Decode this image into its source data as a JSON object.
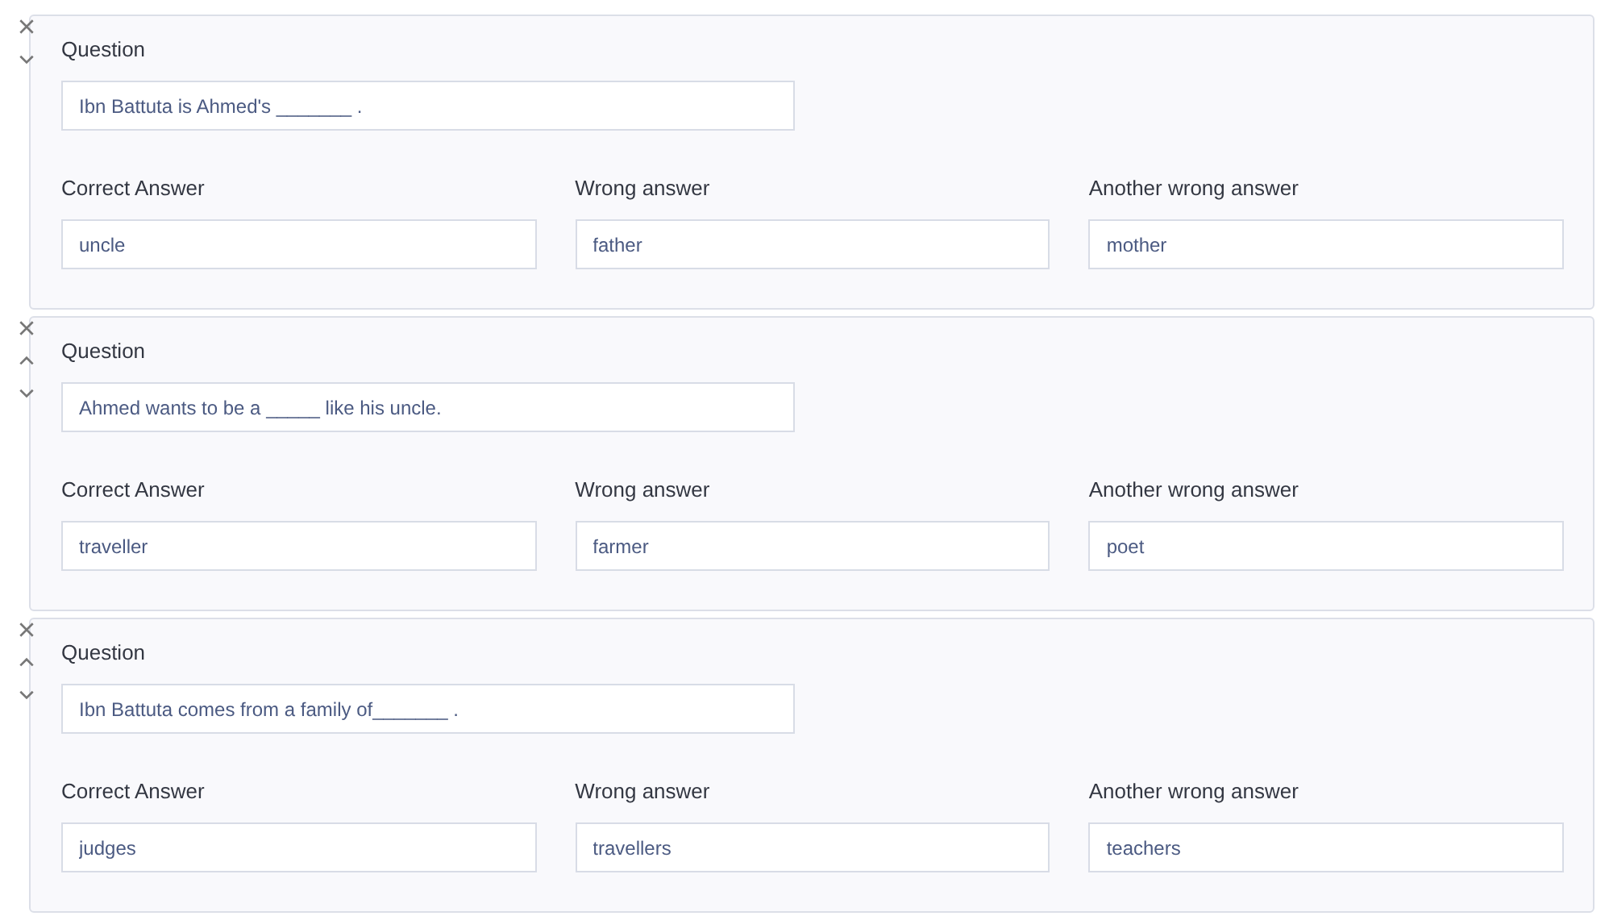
{
  "questions": [
    {
      "label": "Question",
      "text": "Ibn Battuta is Ahmed's _______ .",
      "can_move_up": false,
      "can_move_down": true,
      "answers": [
        {
          "label": "Correct Answer",
          "value": "uncle"
        },
        {
          "label": "Wrong answer",
          "value": "father"
        },
        {
          "label": "Another wrong answer",
          "value": "mother"
        }
      ]
    },
    {
      "label": "Question",
      "text": "Ahmed wants to be a _____ like his uncle.",
      "can_move_up": true,
      "can_move_down": true,
      "answers": [
        {
          "label": "Correct Answer",
          "value": "traveller"
        },
        {
          "label": "Wrong answer",
          "value": "farmer"
        },
        {
          "label": "Another wrong answer",
          "value": "poet"
        }
      ]
    },
    {
      "label": "Question",
      "text": "Ibn Battuta comes from a family of_______ .",
      "can_move_up": true,
      "can_move_down": true,
      "answers": [
        {
          "label": "Correct Answer",
          "value": "judges"
        },
        {
          "label": "Wrong answer",
          "value": "travellers"
        },
        {
          "label": "Another wrong answer",
          "value": "teachers"
        }
      ]
    }
  ]
}
